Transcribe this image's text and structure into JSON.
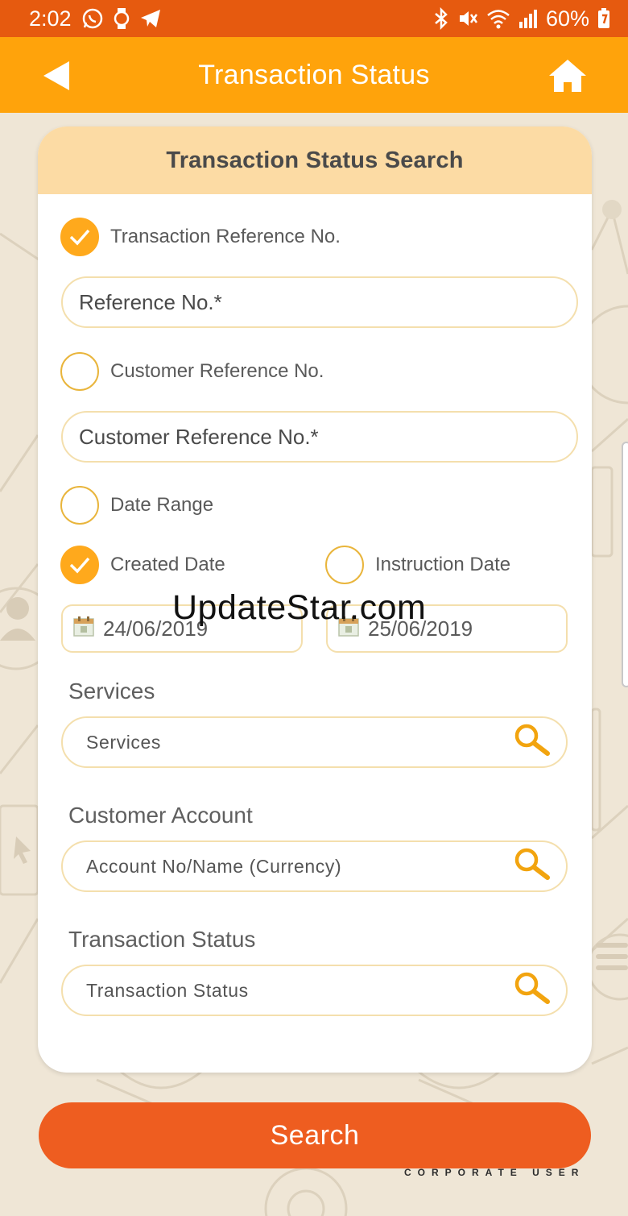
{
  "status_bar": {
    "time": "2:02",
    "battery": "60%"
  },
  "header": {
    "title": "Transaction Status"
  },
  "card": {
    "title": "Transaction Status Search",
    "options": {
      "transaction_ref": {
        "label": "Transaction Reference No.",
        "checked": true
      },
      "customer_ref": {
        "label": "Customer Reference No.",
        "checked": false
      },
      "date_range": {
        "label": "Date Range",
        "checked": false
      },
      "created_date": {
        "label": "Created Date",
        "checked": true
      },
      "instruction_date": {
        "label": "Instruction Date",
        "checked": false
      }
    },
    "reference_input": {
      "placeholder": "Reference No.*"
    },
    "customer_ref_input": {
      "placeholder": "Customer Reference No.*"
    },
    "date_from": "24/06/2019",
    "date_to": "25/06/2019",
    "services": {
      "label": "Services",
      "placeholder": "Services"
    },
    "customer_account": {
      "label": "Customer Account",
      "placeholder": "Account No/Name (Currency)"
    },
    "transaction_status": {
      "label": "Transaction Status",
      "placeholder": "Transaction Status"
    }
  },
  "search_button": "Search",
  "footer_tag": "CORPORATE USER",
  "watermark": "UpdateStar.com",
  "colors": {
    "status_bar": "#e65a0f",
    "header": "#ffa30b",
    "card_head": "#fcdba4",
    "accent": "#ffa91c",
    "search_button": "#ee5d20"
  }
}
